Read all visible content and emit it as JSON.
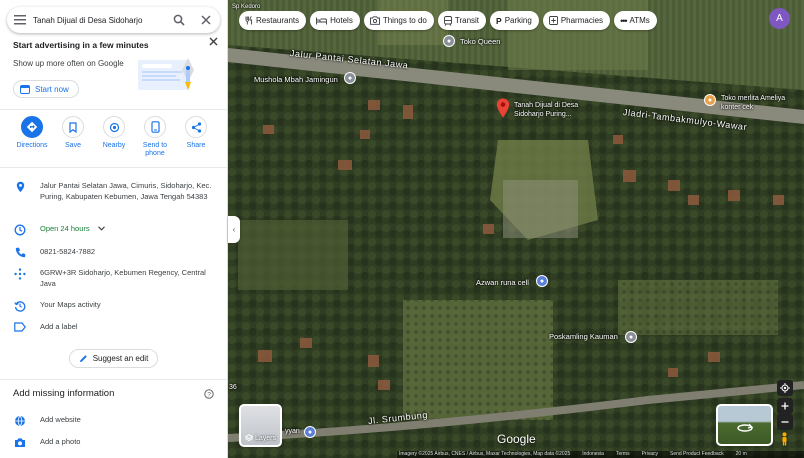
{
  "search": {
    "query": "Tanah Dijual di Desa Sidoharjo"
  },
  "promo": {
    "title": "Start advertising in a few minutes",
    "subtitle": "Show up more often on Google",
    "button": "Start now"
  },
  "actions": [
    {
      "label": "Directions",
      "icon": "directions-icon"
    },
    {
      "label": "Save",
      "icon": "bookmark-icon"
    },
    {
      "label": "Nearby",
      "icon": "nearby-icon"
    },
    {
      "label": "Send to phone",
      "icon": "phone-icon"
    },
    {
      "label": "Share",
      "icon": "share-icon"
    }
  ],
  "details": {
    "address": "Jalur Pantai Selatan Jawa, Cimuris, Sidoharjo, Kec. Puring, Kabupaten Kebumen, Jawa Tengah 54383",
    "hours": "Open 24 hours",
    "phone": "0821-5824-7882",
    "plus_code": "6GRW+3R Sidoharjo, Kebumen Regency, Central Java",
    "activity": "Your Maps activity",
    "label": "Add a label"
  },
  "suggest_edit": "Suggest an edit",
  "missing": {
    "title": "Add missing information",
    "website": "Add website",
    "photo": "Add a photo"
  },
  "chips": [
    "Restaurants",
    "Hotels",
    "Things to do",
    "Transit",
    "Parking",
    "Pharmacies",
    "ATMs"
  ],
  "user_initial": "A",
  "map": {
    "roads": {
      "road_1": "Jalur Pantai Selatan Jawa",
      "road_2": "Jladri-Tambakmulyo-Wawar",
      "road_3": "Jl. Srumbung"
    },
    "places": {
      "toko_queen": "Toko Queen",
      "mushola": "Mushola Mbah Jamingun",
      "pin_label": "Tanah Dijual di Desa Sidoharjo Puring...",
      "toko_merlita": "Toko merlita Ameliya konter cek",
      "azwan": "Azwan runa cell",
      "poskamling": "Poskamling Kauman",
      "top_left_fragment": "Sp Kedoro",
      "edge_left": "36",
      "bottom_fragment": "yyan"
    },
    "layers_label": "Layers",
    "google_logo": "Google",
    "attribution": [
      "Imagery ©2025 Airbus, CNES / Airbus, Maxar Technologies, Map data ©2025",
      "Indonesia",
      "Terms",
      "Privacy",
      "Send Product Feedback",
      "20 m"
    ]
  },
  "colors": {
    "accent": "#1a73e8",
    "open_green": "#188038",
    "pin_red": "#ea4335",
    "avatar": "#7e57c2",
    "poi_blue": "#5a7fd6",
    "poi_orange": "#e8a04a"
  }
}
